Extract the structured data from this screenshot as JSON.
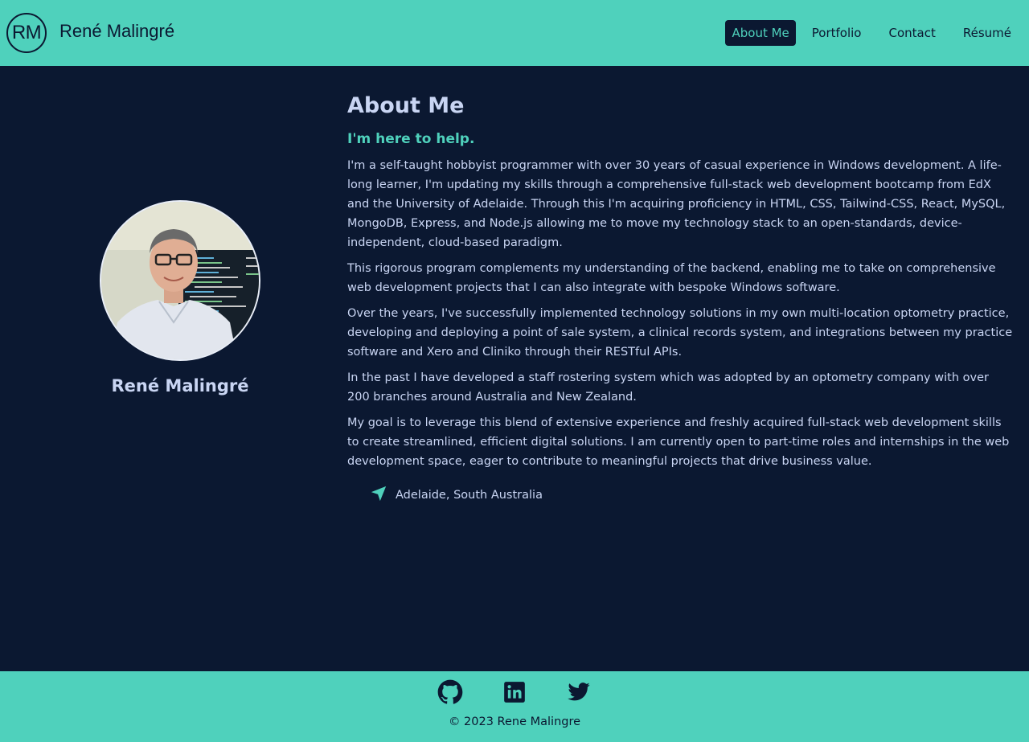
{
  "header": {
    "logo_text": "RM",
    "site_name": "René Malingré",
    "nav": [
      {
        "label": "About Me",
        "active": true
      },
      {
        "label": "Portfolio",
        "active": false
      },
      {
        "label": "Contact",
        "active": false
      },
      {
        "label": "Résumé",
        "active": false
      }
    ]
  },
  "profile": {
    "name": "René Malingré",
    "photo_icon": "profile-photo"
  },
  "main": {
    "title": "About Me",
    "subtitle": "I'm here to help.",
    "paragraphs": [
      "I'm a self-taught hobbyist programmer with over 30 years of casual experience in Windows development. A life-long learner, I'm updating my skills through a comprehensive full-stack web development bootcamp from EdX and the University of Adelaide. Through this I'm acquiring proficiency in HTML, CSS, Tailwind-CSS, React, MySQL, MongoDB, Express, and Node.js allowing me to move my technology stack to an open-standards, device-independent, cloud-based paradigm.",
      "This rigorous program complements my understanding of the backend, enabling me to take on comprehensive web development projects that I can also integrate with bespoke Windows software.",
      "Over the years, I've successfully implemented technology solutions in my own multi-location optometry practice, developing and deploying a point of sale system, a clinical records system, and integrations between my practice software and Xero and Cliniko through their RESTful APIs.",
      "In the past I have developed a staff rostering system which was adopted by an optometry company with over 200 branches around Australia and New Zealand.",
      "My goal is to leverage this blend of extensive experience and freshly acquired full-stack web development skills to create streamlined, efficient digital solutions. I am currently open to part-time roles and internships in the web development space, eager to contribute to meaningful projects that drive business value."
    ],
    "location": {
      "icon": "location-arrow-icon",
      "label": "Adelaide, South Australia"
    }
  },
  "footer": {
    "social": [
      {
        "icon": "github-icon"
      },
      {
        "icon": "linkedin-icon"
      },
      {
        "icon": "twitter-icon"
      }
    ],
    "copyright": "© 2023 Rene Malingre"
  },
  "colors": {
    "accent": "#4fd1bc",
    "background": "#0b1831",
    "text": "#c9d5f3"
  }
}
